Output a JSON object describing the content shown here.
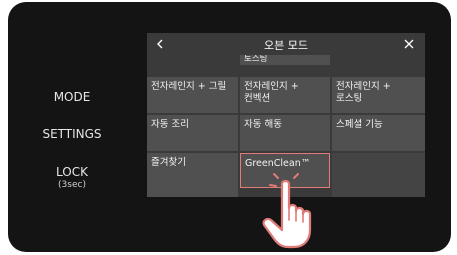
{
  "side_menu": {
    "mode": "MODE",
    "settings": "SETTINGS",
    "lock": "LOCK",
    "lock_sub": "(3sec)"
  },
  "screen": {
    "title": "오븐 모드",
    "back_icon": "chevron-left-icon",
    "close_icon": "close-icon",
    "tiles": {
      "partial": "토스팅",
      "r1c1": "전자레인지 + 그릴",
      "r1c2_line1": "전자레인지 +",
      "r1c2_line2": "컨벡션",
      "r1c3_line1": "전자레인지 +",
      "r1c3_line2": "로스팅",
      "r2c1": "자동 조리",
      "r2c2": "자동 해동",
      "r2c3": "스페셜 기능",
      "r3c1": "즐겨찾기",
      "r3c2": "GreenClean™"
    }
  },
  "colors": {
    "bezel": "#141414",
    "screen_bg": "#3a3a3a",
    "tile": "#505050",
    "highlight": "#e07b78"
  },
  "pointer_icon": "tapping-hand-icon"
}
